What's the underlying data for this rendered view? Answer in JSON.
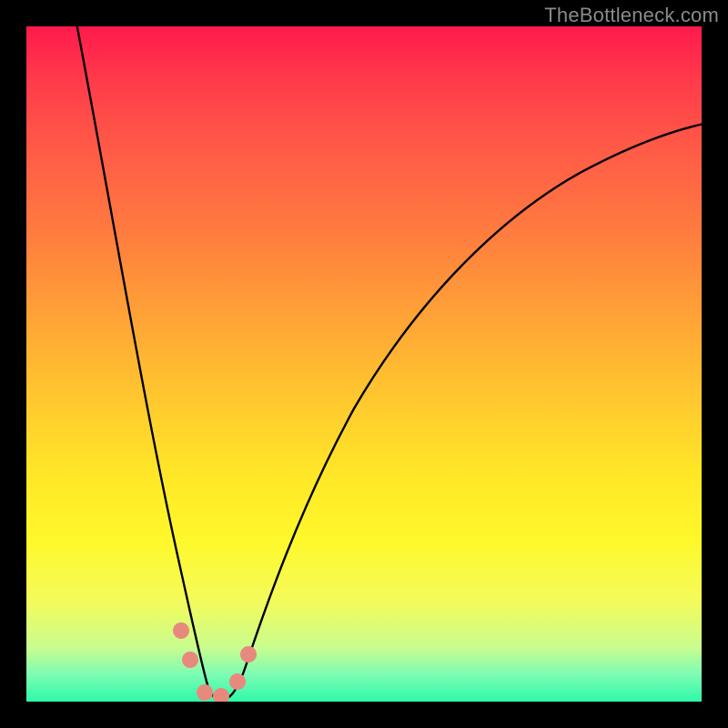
{
  "watermark": "TheBottleneck.com",
  "colors": {
    "top": "#ff1a4d",
    "bottom": "#2ef9a8",
    "curve": "#000000",
    "marker": "#e78a7d",
    "frame": "#000000"
  },
  "chart_data": {
    "type": "line",
    "title": "",
    "xlabel": "",
    "ylabel": "",
    "xlim": [
      0,
      100
    ],
    "ylim": [
      0,
      100
    ],
    "grid": false,
    "legend": false,
    "description": "V-shaped bottleneck curve on a red-to-green vertical gradient; minimum near x≈27 at y≈0",
    "series": [
      {
        "name": "left-branch",
        "x": [
          7,
          11,
          15,
          19,
          22,
          24,
          26
        ],
        "values": [
          100,
          76,
          52,
          30,
          13,
          4,
          0
        ]
      },
      {
        "name": "right-branch",
        "x": [
          29,
          32,
          36,
          42,
          50,
          60,
          72,
          86,
          100
        ],
        "values": [
          0,
          6,
          16,
          30,
          46,
          59,
          71,
          80,
          86
        ]
      }
    ],
    "markers": [
      {
        "name": "marker-left-upper",
        "x": 22.5,
        "y": 10
      },
      {
        "name": "marker-left-lower",
        "x": 24,
        "y": 5
      },
      {
        "name": "marker-bottom-left",
        "x": 26,
        "y": 0.8
      },
      {
        "name": "marker-bottom-mid",
        "x": 28.5,
        "y": 0.6
      },
      {
        "name": "marker-right-lower",
        "x": 31,
        "y": 3
      },
      {
        "name": "marker-right-upper",
        "x": 32.5,
        "y": 7
      }
    ]
  }
}
